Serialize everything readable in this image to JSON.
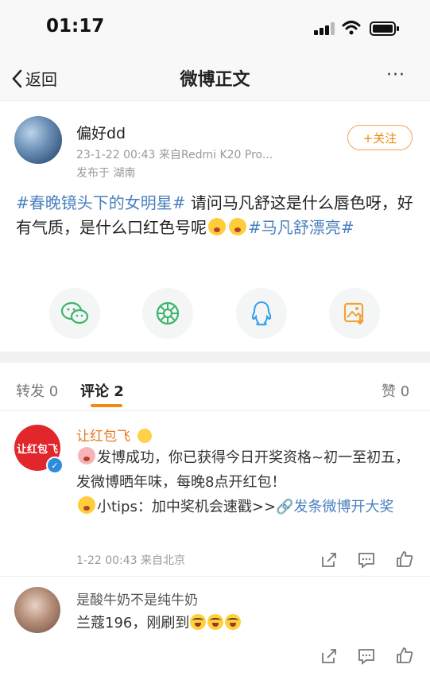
{
  "status_bar": {
    "time": "01:17"
  },
  "nav": {
    "back_label": "返回",
    "title": "微博正文",
    "more": "···"
  },
  "post": {
    "author": "偏好dd",
    "meta": "23-1-22 00:43  来自Redmi K20 Pro...",
    "location": "发布于 湖南",
    "follow_label": "+关注",
    "tag1": "#春晚镜头下的女明星#",
    "text1": " 请问马凡舒这是什么唇色呀，好有气质，是什么口红色号呢",
    "tag2": "#马凡舒漂亮#"
  },
  "share_icons": [
    "wechat-icon",
    "moments-icon",
    "qq-icon",
    "save-image-icon"
  ],
  "tabs": {
    "repost": "转发 0",
    "comment": "评论 2",
    "like": "赞 0"
  },
  "comments": [
    {
      "author": "让红包飞",
      "avatar_text": "让红包飞",
      "line1": "发博成功，你已获得今日开奖资格~初一至初五，发微博晒年味，每晚8点开红包！",
      "line2_prefix": "小tips：加中奖机会速戳>>",
      "line2_link": "发条微博开大奖",
      "time": "1-22 00:43  来自北京"
    },
    {
      "author": "是酸牛奶不是纯牛奶",
      "text": "兰蔻196，刚刷到"
    }
  ],
  "colors": {
    "accent": "#f08a12",
    "link": "#4a7fbf",
    "meta": "#999999"
  }
}
